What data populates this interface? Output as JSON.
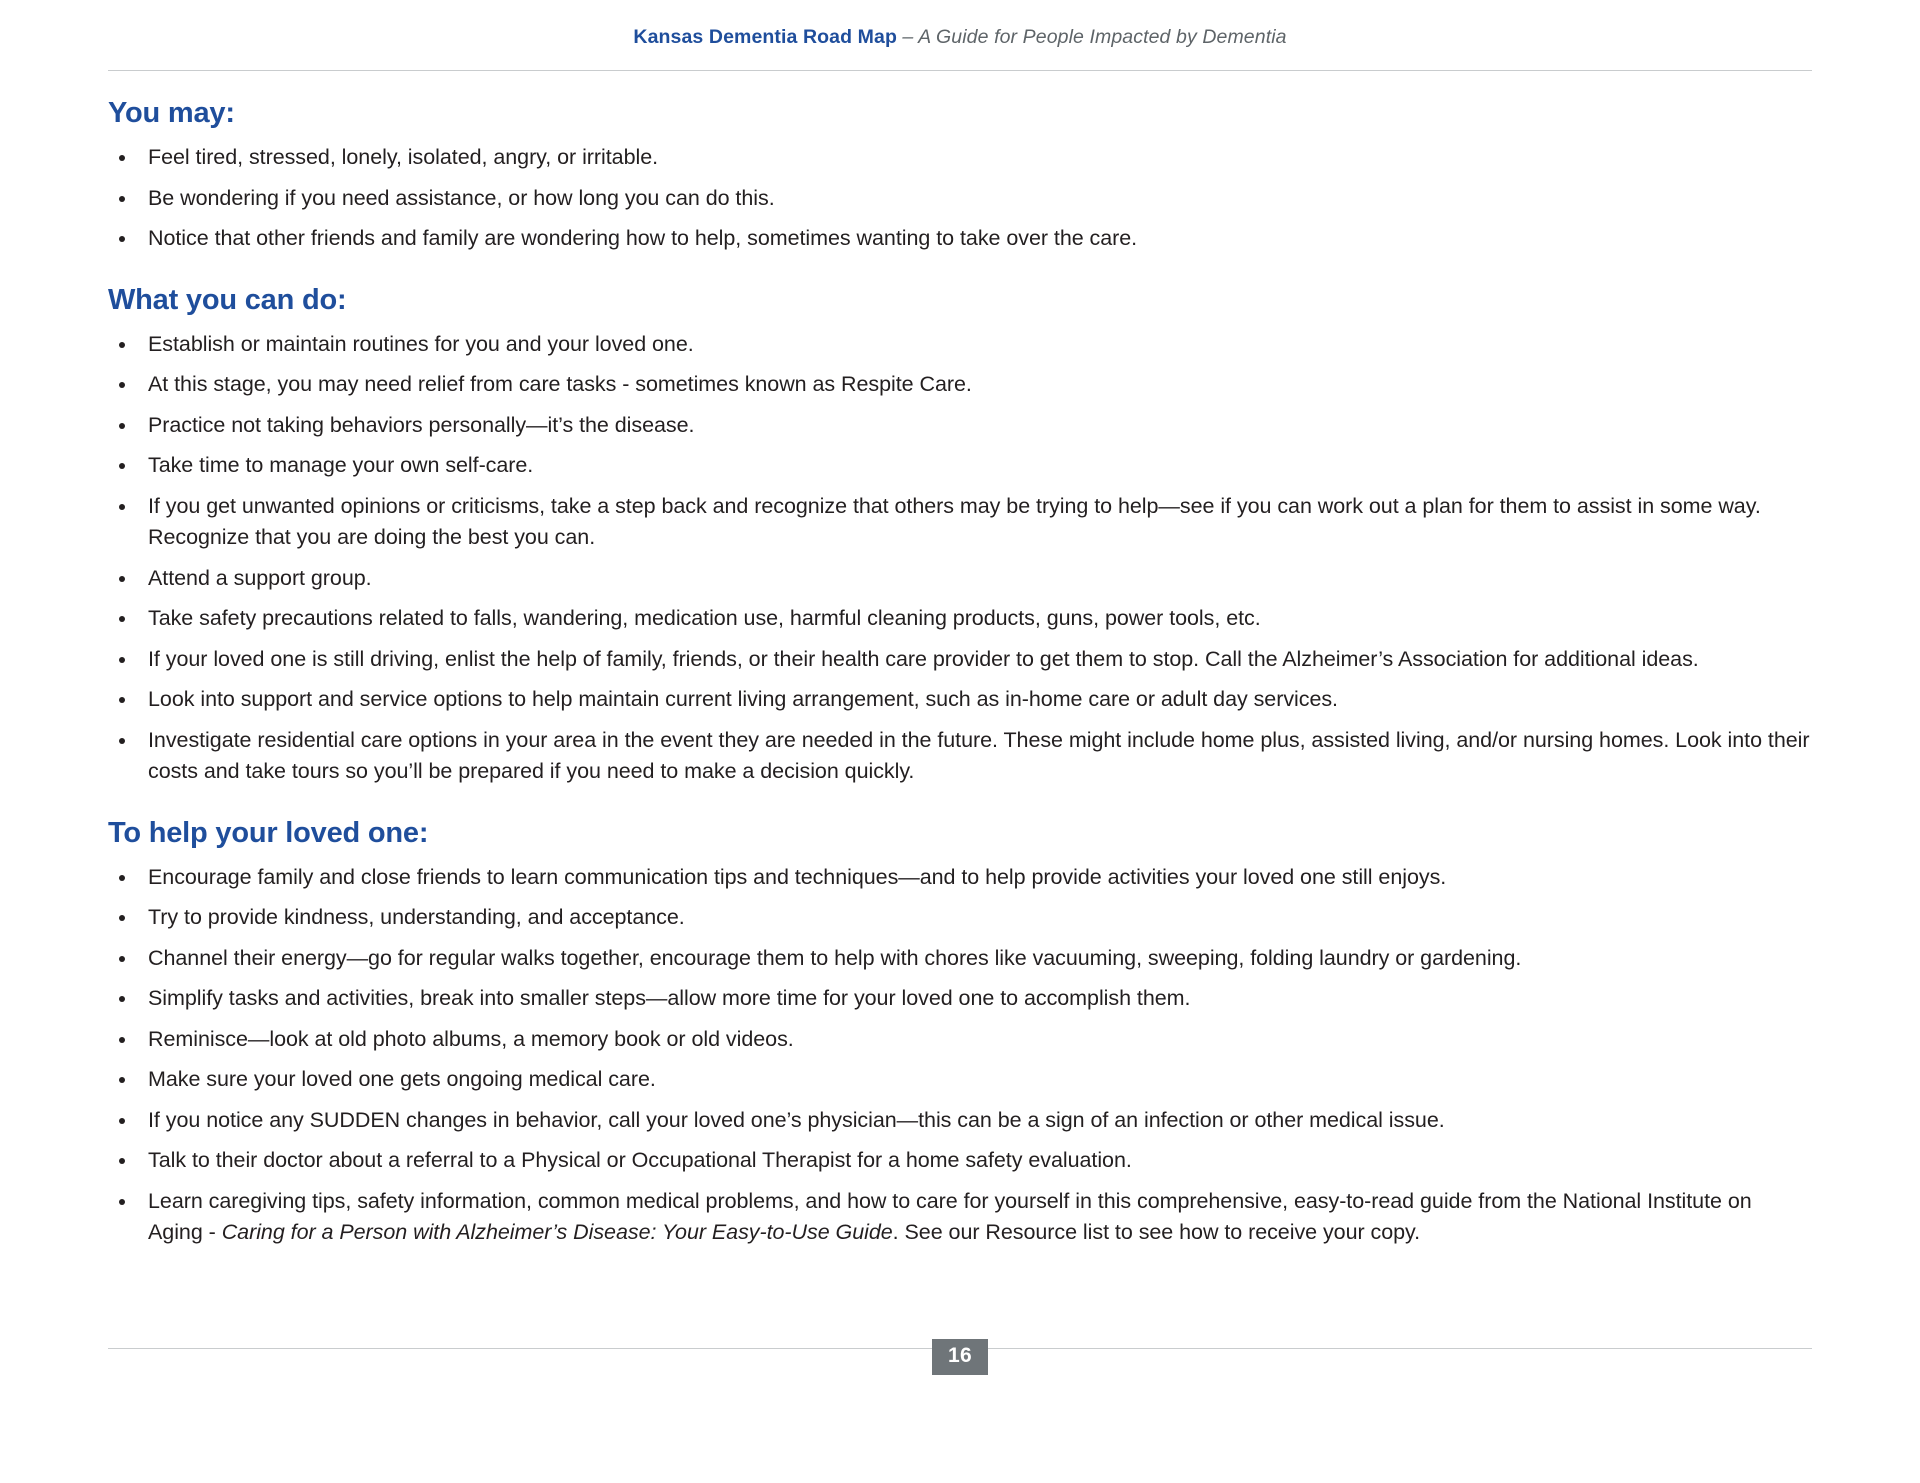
{
  "header": {
    "title": "Kansas Dementia Road Map",
    "subtitle": "– A Guide for People Impacted by Dementia"
  },
  "sections": [
    {
      "heading": "You may:",
      "bullets": [
        "Feel tired, stressed, lonely, isolated, angry, or irritable.",
        "Be wondering if you need assistance, or how long you can do this.",
        "Notice that other friends and family are wondering how to help, sometimes wanting to take over the care."
      ]
    },
    {
      "heading": "What you can do:",
      "bullets": [
        "Establish or maintain routines for you and your loved one.",
        "At this stage, you may need relief from care tasks - sometimes known as Respite Care.",
        "Practice not taking behaviors personally—it’s the disease.",
        "Take time to manage your own self-care.",
        "If you get unwanted opinions or criticisms, take a step back and recognize that others may be trying to help—see if you can work out a plan for them to assist in some way. Recognize that you are doing the best you can.",
        "Attend a support group.",
        "Take safety precautions related to falls, wandering, medication use, harmful cleaning products, guns, power tools, etc.",
        "If your loved one is still driving, enlist the help of family, friends, or their health care provider to get them to stop. Call the Alzheimer’s Association for additional ideas.",
        "Look into support and service options to help maintain current living arrangement, such as in-home care or adult day services.",
        "Investigate residential care options in your area in the event they are needed in the future. These might include home plus, assisted living, and/or nursing homes. Look into their costs and take tours so you’ll be prepared if you need to make a decision quickly."
      ]
    },
    {
      "heading": "To help your loved one:",
      "bullets": [
        "Encourage family and close friends to learn communication tips and techniques—and to help provide activities your loved one still enjoys.",
        "Try to provide kindness, understanding, and acceptance.",
        "Channel their energy—go for regular walks together, encourage them to help with chores like vacuuming, sweeping, folding laundry or gardening.",
        "Simplify tasks and activities, break into smaller steps—allow more time for your loved one to accomplish them.",
        "Reminisce—look at old photo albums, a memory book or old videos.",
        "Make sure your loved one gets ongoing medical care.",
        "If you notice any SUDDEN changes in behavior, call your loved one’s physician—this can be a sign of an infection or other medical issue.",
        "Talk to their doctor about a referral to a Physical or Occupational Therapist for a home safety evaluation.",
        "Learn caregiving tips, safety information, common medical problems, and how to care for yourself in this comprehensive, easy-to-read guide from the National Institute on Aging - "
      ],
      "last_bullet_parts": {
        "lead": "Learn caregiving tips, safety information, common medical problems, and how to care for yourself in this comprehensive, easy-to-read guide from the National Institute on Aging - ",
        "italic_title": "Caring for a Person with Alzheimer’s Disease: Your Easy-to-Use Guide",
        "tail": ". See our Resource list to see how to receive your copy."
      }
    }
  ],
  "footer": {
    "page_number": "16"
  },
  "colors": {
    "heading_blue": "#1f4e9c",
    "body_text": "#231f20",
    "rule_gray": "#c9ccce",
    "page_badge_gray": "#6f7579",
    "subtitle_gray": "#5e6468"
  }
}
